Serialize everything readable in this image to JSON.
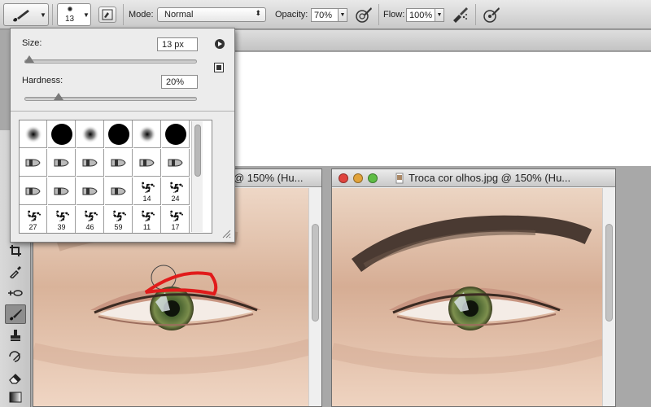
{
  "options_bar": {
    "tool_icon": "brush-icon",
    "brush_size": "13",
    "brush_panel_toggle_icon": "brush-panel-icon",
    "mode_label": "Mode:",
    "mode_value": "Normal",
    "opacity_label": "Opacity:",
    "opacity_value": "70%",
    "opacity_pressure_icon": "tablet-pressure-icon",
    "flow_label": "Flow:",
    "flow_value": "100%",
    "airbrush_icon": "airbrush-icon",
    "size_pressure_icon": "tablet-size-pressure-icon"
  },
  "brush_panel": {
    "size_label": "Size:",
    "size_value": "13 px",
    "size_slider": 0.03,
    "hardness_label": "Hardness:",
    "hardness_value": "20%",
    "hardness_slider": 0.2,
    "menu_icon": "panel-menu-arrow-icon",
    "new_preset_icon": "new-preset-icon",
    "presets": [
      {
        "kind": "soft",
        "label": ""
      },
      {
        "kind": "hard",
        "label": ""
      },
      {
        "kind": "soft",
        "label": ""
      },
      {
        "kind": "hard",
        "label": ""
      },
      {
        "kind": "soft",
        "label": ""
      },
      {
        "kind": "hard",
        "label": ""
      },
      {
        "kind": "tip",
        "label": ""
      },
      {
        "kind": "tip",
        "label": ""
      },
      {
        "kind": "tip",
        "label": ""
      },
      {
        "kind": "tip",
        "label": ""
      },
      {
        "kind": "tip",
        "label": ""
      },
      {
        "kind": "tip",
        "label": ""
      },
      {
        "kind": "tip",
        "label": ""
      },
      {
        "kind": "tip",
        "label": ""
      },
      {
        "kind": "tip",
        "label": ""
      },
      {
        "kind": "tip",
        "label": ""
      },
      {
        "kind": "splatter",
        "label": "14"
      },
      {
        "kind": "splatter",
        "label": "24"
      },
      {
        "kind": "splatter",
        "label": "27"
      },
      {
        "kind": "splatter",
        "label": "39"
      },
      {
        "kind": "splatter",
        "label": "46"
      },
      {
        "kind": "splatter",
        "label": "59"
      },
      {
        "kind": "splatter",
        "label": "11"
      },
      {
        "kind": "splatter",
        "label": "17"
      }
    ]
  },
  "toolbox": {
    "tools": [
      "crop-icon",
      "eyedropper-icon",
      "spot-healing-icon",
      "brush-icon",
      "clone-stamp-icon",
      "history-brush-icon",
      "eraser-icon",
      "gradient-icon"
    ]
  },
  "documents": [
    {
      "title": "@ 150% (Hu..."
    },
    {
      "title": "Troca cor olhos.jpg @ 150% (Hu..."
    }
  ],
  "colors": {
    "close": "#e0443e",
    "minimize": "#e2a33a",
    "zoom": "#5fbd45",
    "annotation": "#e11b1b"
  }
}
